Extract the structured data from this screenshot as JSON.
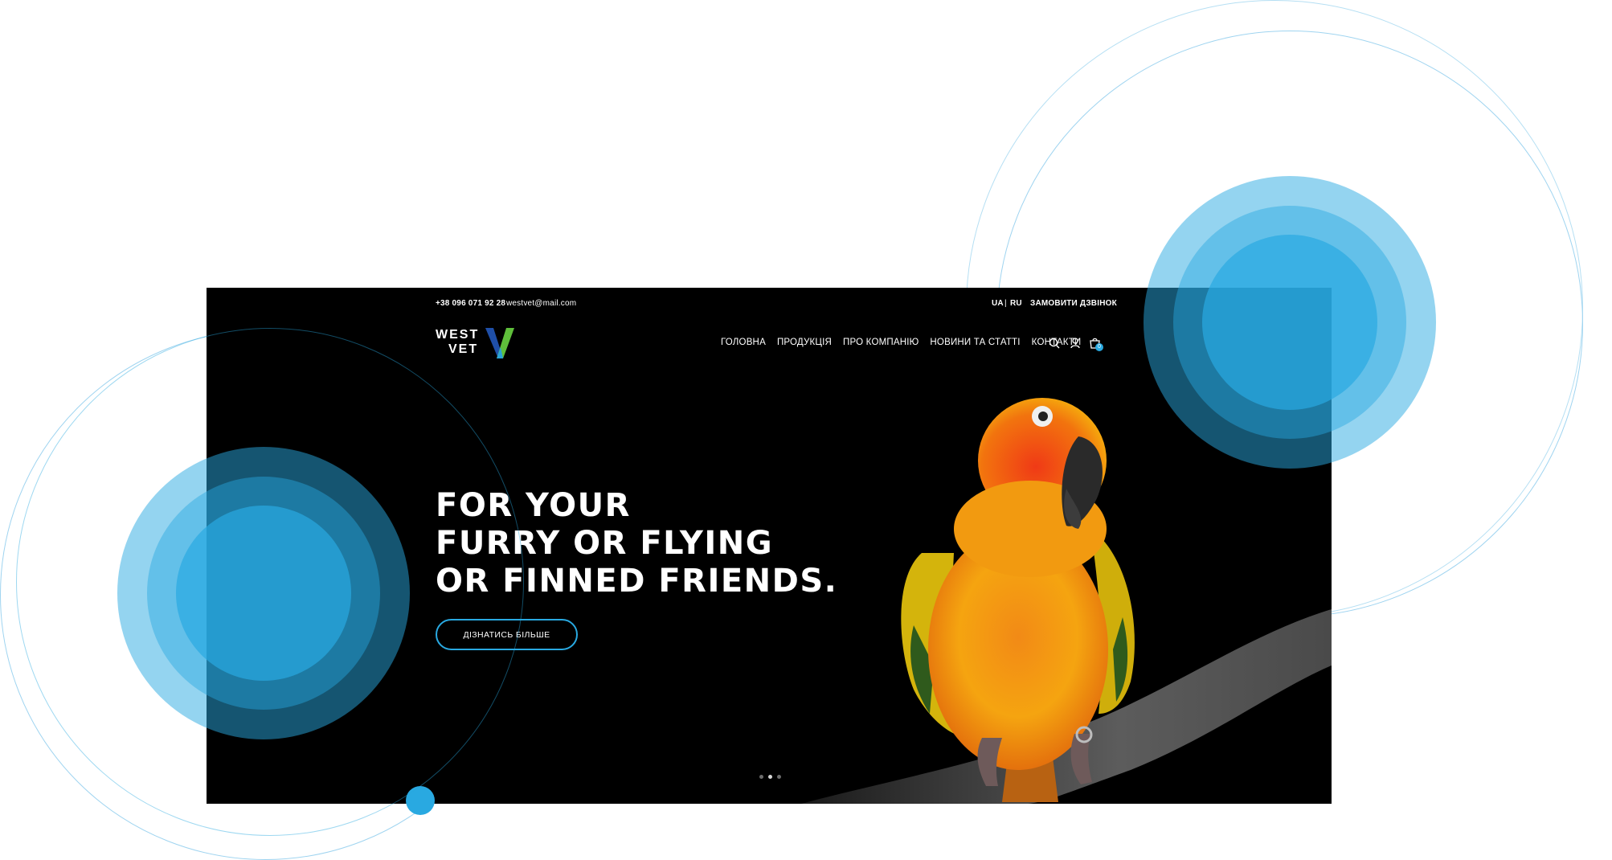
{
  "topbar": {
    "phone": "+38 096 071 92 28",
    "email": "westvet@mail.com",
    "lang_ua": "UA",
    "lang_sep": "|",
    "lang_ru": "RU",
    "callback": "ЗАМОВИТИ ДЗВІНОК"
  },
  "logo": {
    "line1": "WEST",
    "line2": "VET"
  },
  "nav": {
    "items": [
      "ГОЛОВНА",
      "ПРОДУКЦІЯ",
      "ПРО КОМПАНІЮ",
      "НОВИНИ ТА СТАТТІ",
      "КОНТАКТИ"
    ]
  },
  "icons": {
    "search": "search-icon",
    "user": "user-icon",
    "cart": "cart-icon"
  },
  "cart": {
    "count": "0"
  },
  "hero": {
    "headline": [
      "FOR YOUR",
      "FURRY OR FLYING",
      "OR FINNED FRIENDS."
    ],
    "cta": "ДІЗНАТИСЬ БІЛЬШЕ",
    "slider": {
      "slides": 3,
      "active": 2
    }
  },
  "colors": {
    "accent": "#29a9e1",
    "background": "#000000",
    "logo_blue": "#1f4fa8",
    "logo_green": "#5fbf3b"
  }
}
